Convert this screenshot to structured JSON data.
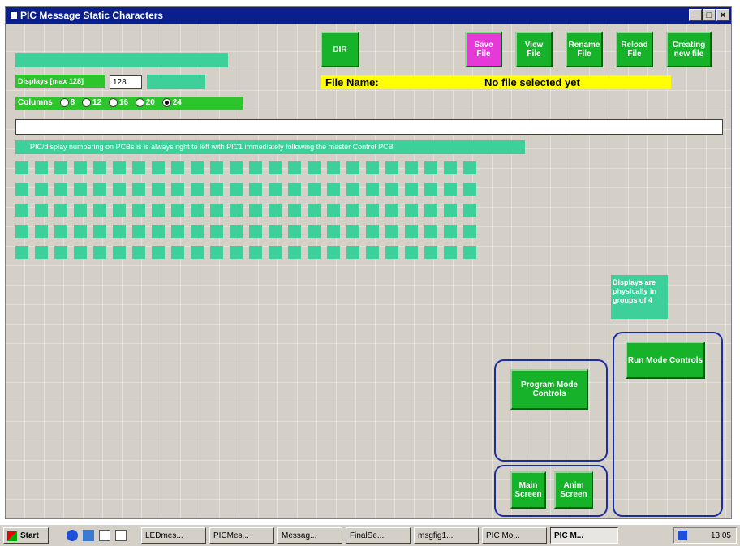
{
  "window": {
    "title": "PIC Message Static Characters",
    "controls": [
      "_",
      "□",
      "×"
    ]
  },
  "toolbar": {
    "dir": "DIR",
    "save_file": "Save File",
    "view_file": "View File",
    "rename_file": "Rename File",
    "reload_file": "Reload File",
    "new_file": "Creating new file"
  },
  "colors": {
    "save": "#e63ad8",
    "green": "#16b22a",
    "teal": "#3ed09a",
    "title": "#0a1e8c",
    "filename_bg": "#ffff00"
  },
  "displays": {
    "label": "Displays [max 128]",
    "value": "128"
  },
  "columns": {
    "label": "Columns",
    "options": [
      "8",
      "12",
      "16",
      "20",
      "24"
    ],
    "selected": "24"
  },
  "file": {
    "label": "File Name:",
    "value": "No file selected yet"
  },
  "message_input": "",
  "note": "PIC/display numbering on PCBs is is always right to left with PIC1 immediately following the master Control PCB",
  "grid": {
    "rows": 5,
    "cols": 24
  },
  "groups_note": "Displays are physically in groups of 4",
  "run_mode": "Run Mode Controls",
  "program_mode": "Program Mode Controls",
  "main_screen": "Main Screen",
  "anim_screen": "Anim Screen",
  "taskbar": {
    "start": "Start",
    "tasks": [
      "LEDmes...",
      "PICMes...",
      "Messag...",
      "FinalSe...",
      "msgfig1...",
      "PIC Mo...",
      "PIC M..."
    ],
    "clock": "13:05"
  }
}
